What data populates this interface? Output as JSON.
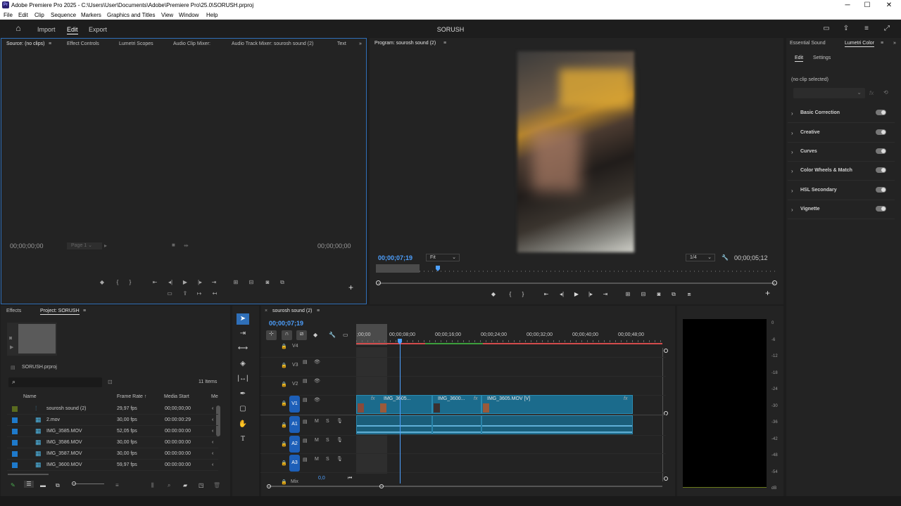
{
  "window": {
    "logo": "Pr",
    "title": "Adobe Premiere Pro 2025 - C:\\Users\\User\\Documents\\Adobe\\Premiere Pro\\25.0\\SORUSH.prproj",
    "minimize": "─",
    "maximize": "☐",
    "close": "✕"
  },
  "menu": [
    "File",
    "Edit",
    "Clip",
    "Sequence",
    "Markers",
    "Graphics and Titles",
    "View",
    "Window",
    "Help"
  ],
  "header": {
    "nav": [
      "Import",
      "Edit",
      "Export"
    ],
    "active_nav": "Edit",
    "project_name": "SORUSH"
  },
  "source_panel": {
    "tabs": [
      "Source: (no clips)",
      "Effect Controls",
      "Lumetri Scopes",
      "Audio Clip Mixer:",
      "Audio Track Mixer: sourosh sound (2)",
      "Text"
    ],
    "timecode_left": "00;00;00;00",
    "timecode_right": "00;00;00;00",
    "page": "Page 1"
  },
  "program_panel": {
    "title": "Program: sourosh sound (2)",
    "timecode": "00;00;07;19",
    "fit": "Fit",
    "resolution": "1/4",
    "duration": "00;00;05;12"
  },
  "lumetri": {
    "tabs": [
      "Essential Sound",
      "Lumetri Color"
    ],
    "subtabs": [
      "Edit",
      "Settings"
    ],
    "no_clip": "(no clip selected)",
    "sections": [
      "Basic Correction",
      "Creative",
      "Curves",
      "Color Wheels & Match",
      "HSL Secondary",
      "Vignette"
    ]
  },
  "project_panel": {
    "tabs": [
      "Effects",
      "Project: SORUSH"
    ],
    "file": "SORUSH.prproj",
    "item_count": "11 Items",
    "columns": [
      "Name",
      "Frame Rate",
      "Media Start",
      "Me"
    ],
    "rows": [
      {
        "name": "sourosh sound (2)",
        "fps": "29,97 fps",
        "start": "00;00;00;00",
        "color": "#5a6b1f"
      },
      {
        "name": "2.mov",
        "fps": "30,00 fps",
        "start": "00:00:00:29",
        "color": "#1e7acb"
      },
      {
        "name": "IMG_3585.MOV",
        "fps": "52,05 fps",
        "start": "00:00:00:00",
        "color": "#1e7acb"
      },
      {
        "name": "IMG_3586.MOV",
        "fps": "30,00 fps",
        "start": "00:00:00:00",
        "color": "#1e7acb"
      },
      {
        "name": "IMG_3587.MOV",
        "fps": "30,00 fps",
        "start": "00:00:00:00",
        "color": "#1e7acb"
      },
      {
        "name": "IMG_3600.MOV",
        "fps": "59,97 fps",
        "start": "00:00:00:00",
        "color": "#1e7acb"
      }
    ]
  },
  "timeline": {
    "sequence": "sourosh sound (2)",
    "timecode": "00;00;07;19",
    "ruler": [
      ";00;00",
      "00;00;08;00",
      "00;00;16;00",
      "00;00;24;00",
      "00;00;32;00",
      "00;00;40;00",
      "00;00;48;00"
    ],
    "video_tracks": [
      "V4",
      "V3",
      "V2",
      "V1"
    ],
    "audio_tracks": [
      "A1",
      "A2",
      "A3"
    ],
    "mix": "Mix",
    "mix_value": "0,0",
    "clips": [
      "IMG_3605...",
      "IMG_3600...",
      "IMG_3605.MOV [V]"
    ]
  },
  "meter_scale": [
    "0",
    "-6",
    "-12",
    "-18",
    "-24",
    "-30",
    "-36",
    "-42",
    "-48",
    "-54",
    "dB"
  ]
}
